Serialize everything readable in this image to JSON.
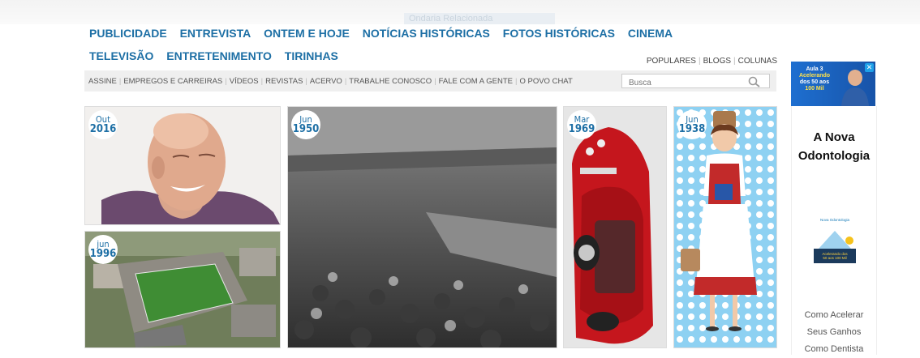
{
  "ghost_tab": "Ondaria Relacionada",
  "nav": {
    "row1": [
      "PUBLICIDADE",
      "ENTREVISTA",
      "ONTEM E HOJE",
      "NOTÍCIAS HISTÓRICAS",
      "FOTOS HISTÓRICAS",
      "CINEMA"
    ],
    "row2": [
      "TELEVISÃO",
      "ENTRETENIMENTO",
      "TIRINHAS"
    ]
  },
  "top_links": [
    "POPULARES",
    "BLOGS",
    "COLUNAS"
  ],
  "sub_links": [
    "ASSINE",
    "EMPREGOS E CARREIRAS",
    "VÍDEOS",
    "REVISTAS",
    "ACERVO",
    "TRABALHE CONOSCO",
    "FALE COM A GENTE",
    "O POVO CHAT"
  ],
  "search": {
    "placeholder": "Busca"
  },
  "tiles": [
    {
      "month": "Out",
      "year": "2016"
    },
    {
      "month": "jun",
      "year": "1996"
    },
    {
      "month": "Jun",
      "year": "1950"
    },
    {
      "month": "Mar",
      "year": "1969"
    },
    {
      "month": "Jun",
      "year": "1938"
    }
  ],
  "ad": {
    "top_line1": "Aula 3",
    "top_line2": "Acelerando",
    "top_line3": "dos 50 aos",
    "top_line4": "100 Mil",
    "close": "✕",
    "title_line1": "A Nova",
    "title_line2": "Odontologia",
    "logo_text": "Nova Odontologia",
    "logo_sub1": "Acelerando dos",
    "logo_sub2": "50 aos 100 Mil",
    "links": [
      "Como Acelerar",
      "Seus Ganhos",
      "Como Dentista"
    ]
  }
}
